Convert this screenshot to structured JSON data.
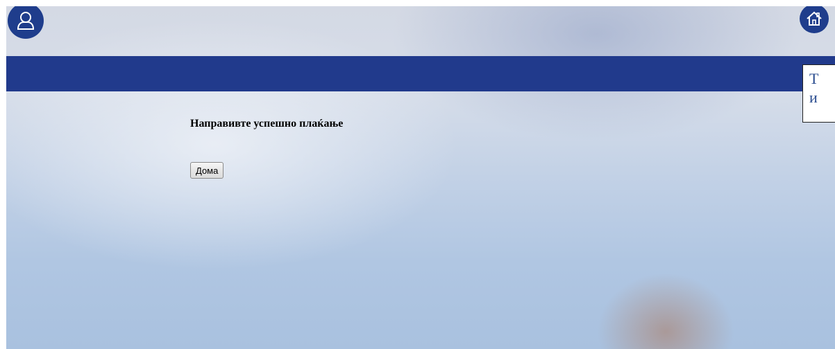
{
  "header": {
    "user_icon": "user-icon",
    "home_icon": "home-icon",
    "colors": {
      "nav_band": "#213a8c",
      "icon_circle": "#1f3d8c"
    }
  },
  "side_notice": {
    "line1": "Т",
    "line2": "и"
  },
  "main": {
    "message": "Направивте успешно плаќање",
    "home_button_label": "Дома"
  }
}
